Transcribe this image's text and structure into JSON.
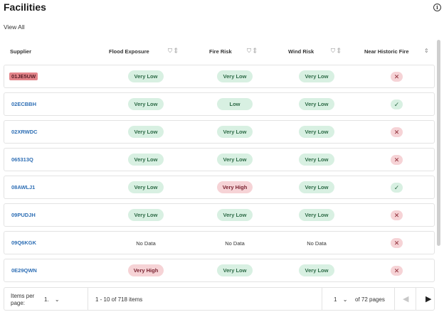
{
  "page": {
    "title": "Facilities",
    "view_all": "View All"
  },
  "table": {
    "columns": {
      "supplier": "Supplier",
      "flood": "Flood Exposure",
      "fire": "Fire Risk",
      "wind": "Wind Risk",
      "historic": "Near Historic Fire"
    },
    "rows": [
      {
        "supplier": "01JE5UW",
        "flood": "Very Low",
        "fire": "Very Low",
        "wind": "Very Low",
        "historic": false,
        "highlighted": true
      },
      {
        "supplier": "02ECBBH",
        "flood": "Very Low",
        "fire": "Low",
        "wind": "Very Low",
        "historic": true
      },
      {
        "supplier": "02XRWDC",
        "flood": "Very Low",
        "fire": "Very Low",
        "wind": "Very Low",
        "historic": false
      },
      {
        "supplier": "065313Q",
        "flood": "Very Low",
        "fire": "Very Low",
        "wind": "Very Low",
        "historic": false
      },
      {
        "supplier": "08AWLJ1",
        "flood": "Very Low",
        "fire": "Very High",
        "wind": "Very Low",
        "historic": true
      },
      {
        "supplier": "09PUDJH",
        "flood": "Very Low",
        "fire": "Very Low",
        "wind": "Very Low",
        "historic": false
      },
      {
        "supplier": "09Q6KGK",
        "flood": "No Data",
        "fire": "No Data",
        "wind": "No Data",
        "historic": false
      },
      {
        "supplier": "0E29QWN",
        "flood": "Very High",
        "fire": "Very Low",
        "wind": "Very Low",
        "historic": false
      }
    ]
  },
  "pagination": {
    "items_per_page_label": "Items per page:",
    "items_per_page_value": "1.",
    "range_text": "1 - 10 of 718 items",
    "current_page": "1",
    "pages_text": "of 72 pages"
  },
  "colors": {
    "link": "#2f6fb5",
    "low_bg": "#d8f0e2",
    "high_bg": "#f6d3d6",
    "highlight": "#e3848a"
  },
  "icons": {
    "info": "info-icon",
    "filter": "filter-icon",
    "sort": "sort-icon",
    "cross": "cross-icon",
    "check": "check-icon"
  }
}
